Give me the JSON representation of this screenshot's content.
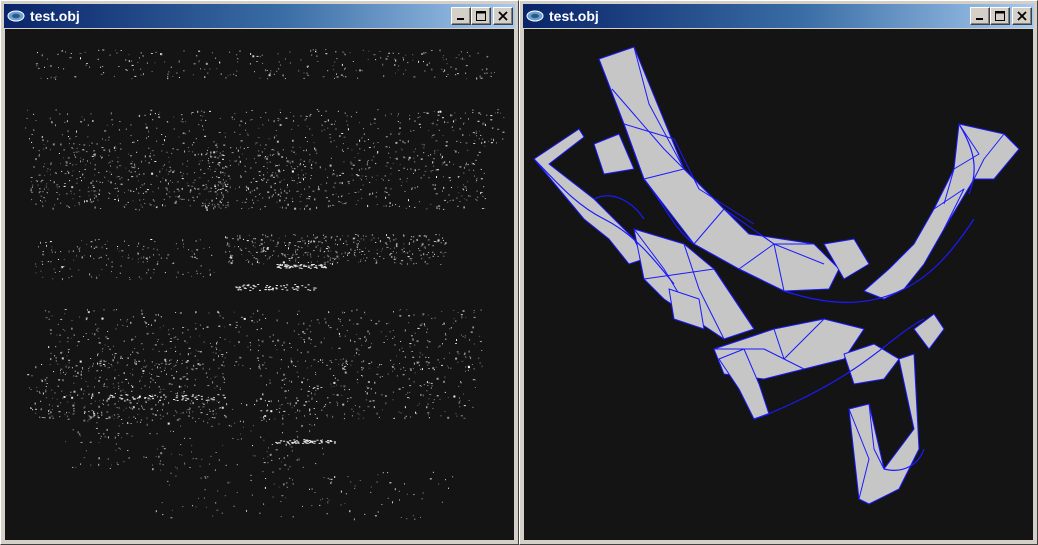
{
  "windows": [
    {
      "title": "test.obj",
      "view": "point-cloud",
      "controls": {
        "minimize": "minimize",
        "maximize": "maximize",
        "close": "close"
      }
    },
    {
      "title": "test.obj",
      "view": "wireframe-shaded",
      "controls": {
        "minimize": "minimize",
        "maximize": "maximize",
        "close": "close"
      }
    }
  ],
  "colors": {
    "title_gradient_start": "#0a246a",
    "title_gradient_end": "#a6caf0",
    "viewport_background": "#141414",
    "mesh_fill": "#c8c8c8",
    "wireframe": "#1a1aff",
    "points": "#d0d0d0"
  },
  "icons": [
    "app-window-icon",
    "minimize-icon",
    "maximize-icon",
    "close-icon"
  ]
}
